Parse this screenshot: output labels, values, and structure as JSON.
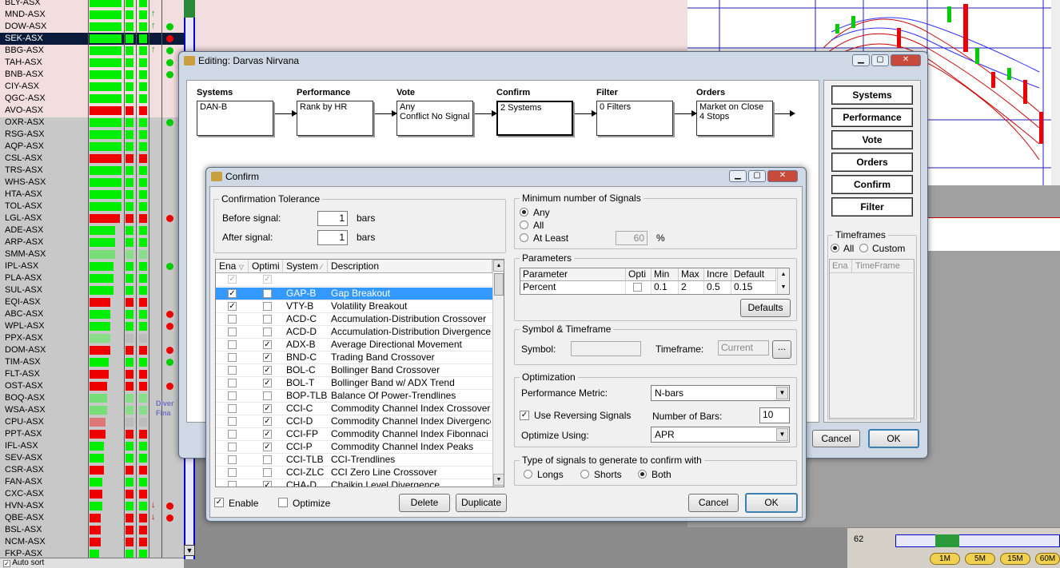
{
  "tickers": [
    {
      "sym": "BLY-ASX",
      "bar": 40,
      "bc": "#00ee00",
      "c1": "#00ee00",
      "c2": "#00ee00",
      "dot": null,
      "arr": ""
    },
    {
      "sym": "MND-ASX",
      "bar": 40,
      "bc": "#00ee00",
      "c1": "#00ee00",
      "c2": "#00ee00",
      "dot": null,
      "arr": "↑"
    },
    {
      "sym": "DOW-ASX",
      "bar": 40,
      "bc": "#00ee00",
      "c1": "#00ee00",
      "c2": "#00ee00",
      "dot": "#00cc00",
      "arr": "↑"
    },
    {
      "sym": "SEK-ASX",
      "bar": 40,
      "bc": "#00ee00",
      "c1": "#00ee00",
      "c2": "#00ee00",
      "dot": "#ee0000",
      "arr": "",
      "sel": true
    },
    {
      "sym": "BBG-ASX",
      "bar": 40,
      "bc": "#00ee00",
      "c1": "#00ee00",
      "c2": "#00ee00",
      "dot": "#00cc00",
      "arr": "↑"
    },
    {
      "sym": "TAH-ASX",
      "bar": 40,
      "bc": "#00ee00",
      "c1": "#00ee00",
      "c2": "#00ee00",
      "dot": "#00cc00",
      "arr": ""
    },
    {
      "sym": "BNB-ASX",
      "bar": 40,
      "bc": "#00ee00",
      "c1": "#00ee00",
      "c2": "#00ee00",
      "dot": "#00cc00",
      "arr": ""
    },
    {
      "sym": "CIY-ASX",
      "bar": 40,
      "bc": "#00ee00",
      "c1": "#00ee00",
      "c2": "#00ee00",
      "dot": null,
      "arr": ""
    },
    {
      "sym": "QGC-ASX",
      "bar": 40,
      "bc": "#00ee00",
      "c1": "#00ee00",
      "c2": "#00ee00",
      "dot": null,
      "arr": ""
    },
    {
      "sym": "AVO-ASX",
      "bar": 40,
      "bc": "#ee0000",
      "c1": "#ee0000",
      "c2": "#ee0000",
      "dot": null,
      "arr": ""
    },
    {
      "sym": "OXR-ASX",
      "bar": 40,
      "bc": "#00ee00",
      "c1": "#00ee00",
      "c2": "#00ee00",
      "dot": "#00cc00",
      "arr": ""
    },
    {
      "sym": "RSG-ASX",
      "bar": 40,
      "bc": "#00ee00",
      "c1": "#00ee00",
      "c2": "#00ee00",
      "dot": null,
      "arr": ""
    },
    {
      "sym": "AQP-ASX",
      "bar": 40,
      "bc": "#00ee00",
      "c1": "#00ee00",
      "c2": "#00ee00",
      "dot": null,
      "arr": ""
    },
    {
      "sym": "CSL-ASX",
      "bar": 40,
      "bc": "#ee0000",
      "c1": "#ee0000",
      "c2": "#ee0000",
      "dot": null,
      "arr": ""
    },
    {
      "sym": "TRS-ASX",
      "bar": 40,
      "bc": "#00ee00",
      "c1": "#00ee00",
      "c2": "#00ee00",
      "dot": null,
      "arr": ""
    },
    {
      "sym": "WHS-ASX",
      "bar": 40,
      "bc": "#00ee00",
      "c1": "#00ee00",
      "c2": "#00ee00",
      "dot": null,
      "arr": ""
    },
    {
      "sym": "HTA-ASX",
      "bar": 40,
      "bc": "#00ee00",
      "c1": "#00ee00",
      "c2": "#00ee00",
      "dot": null,
      "arr": ""
    },
    {
      "sym": "TOL-ASX",
      "bar": 40,
      "bc": "#00ee00",
      "c1": "#00ee00",
      "c2": "#00ee00",
      "dot": null,
      "arr": ""
    },
    {
      "sym": "LGL-ASX",
      "bar": 38,
      "bc": "#ee0000",
      "c1": "#ee0000",
      "c2": "#ee0000",
      "dot": "#ee0000",
      "arr": ""
    },
    {
      "sym": "ADE-ASX",
      "bar": 32,
      "bc": "#00ee00",
      "c1": "#00ee00",
      "c2": "#00ee00",
      "dot": null,
      "arr": ""
    },
    {
      "sym": "ARP-ASX",
      "bar": 32,
      "bc": "#00ee00",
      "c1": "#00ee00",
      "c2": "#00ee00",
      "dot": null,
      "arr": ""
    },
    {
      "sym": "SMM-ASX",
      "bar": 32,
      "bc": "#77dd77",
      "c1": "#88dd88",
      "c2": "#88dd88",
      "dot": null,
      "arr": ""
    },
    {
      "sym": "IPL-ASX",
      "bar": 30,
      "bc": "#00ee00",
      "c1": "#00ee00",
      "c2": "#00ee00",
      "dot": "#00cc00",
      "arr": ""
    },
    {
      "sym": "PLA-ASX",
      "bar": 30,
      "bc": "#00ee00",
      "c1": "#00ee00",
      "c2": "#00ee00",
      "dot": null,
      "arr": ""
    },
    {
      "sym": "SUL-ASX",
      "bar": 30,
      "bc": "#00ee00",
      "c1": "#00ee00",
      "c2": "#00ee00",
      "dot": null,
      "arr": ""
    },
    {
      "sym": "EQI-ASX",
      "bar": 26,
      "bc": "#ee0000",
      "c1": "#ee0000",
      "c2": "#ee0000",
      "dot": null,
      "arr": ""
    },
    {
      "sym": "ABC-ASX",
      "bar": 26,
      "bc": "#00ee00",
      "c1": "#00ee00",
      "c2": "#00ee00",
      "dot": "#ee0000",
      "arr": ""
    },
    {
      "sym": "WPL-ASX",
      "bar": 26,
      "bc": "#00ee00",
      "c1": "#00ee00",
      "c2": "#00ee00",
      "dot": "#ee0000",
      "arr": ""
    },
    {
      "sym": "PPX-ASX",
      "bar": 26,
      "bc": "#88dd88",
      "c1": "#bbbbbb",
      "c2": "#bbbbbb",
      "dot": null,
      "arr": ""
    },
    {
      "sym": "DOM-ASX",
      "bar": 26,
      "bc": "#ee0000",
      "c1": "#ee0000",
      "c2": "#ee0000",
      "dot": "#ee0000",
      "arr": ""
    },
    {
      "sym": "TIM-ASX",
      "bar": 24,
      "bc": "#00ee00",
      "c1": "#00ee00",
      "c2": "#00ee00",
      "dot": "#00cc00",
      "arr": ""
    },
    {
      "sym": "FLT-ASX",
      "bar": 24,
      "bc": "#ee0000",
      "c1": "#ee0000",
      "c2": "#ee0000",
      "dot": null,
      "arr": ""
    },
    {
      "sym": "OST-ASX",
      "bar": 22,
      "bc": "#ee0000",
      "c1": "#ee0000",
      "c2": "#ee0000",
      "dot": "#ee0000",
      "arr": ""
    },
    {
      "sym": "BOQ-ASX",
      "bar": 22,
      "bc": "#77dd77",
      "c1": "#88dd88",
      "c2": "#88dd88",
      "dot": null,
      "arr": ""
    },
    {
      "sym": "WSA-ASX",
      "bar": 22,
      "bc": "#77dd77",
      "c1": "#88dd88",
      "c2": "#88dd88",
      "dot": null,
      "arr": ""
    },
    {
      "sym": "CPU-ASX",
      "bar": 20,
      "bc": "#dd7777",
      "c1": "#bbbbbb",
      "c2": "#bbbbbb",
      "dot": null,
      "arr": ""
    },
    {
      "sym": "PPT-ASX",
      "bar": 20,
      "bc": "#ee0000",
      "c1": "#ee0000",
      "c2": "#ee0000",
      "dot": null,
      "arr": ""
    },
    {
      "sym": "IFL-ASX",
      "bar": 18,
      "bc": "#00ee00",
      "c1": "#00ee00",
      "c2": "#00ee00",
      "dot": null,
      "arr": ""
    },
    {
      "sym": "SEV-ASX",
      "bar": 18,
      "bc": "#00ee00",
      "c1": "#00ee00",
      "c2": "#00ee00",
      "dot": null,
      "arr": ""
    },
    {
      "sym": "CSR-ASX",
      "bar": 18,
      "bc": "#ee0000",
      "c1": "#ee0000",
      "c2": "#ee0000",
      "dot": null,
      "arr": ""
    },
    {
      "sym": "FAN-ASX",
      "bar": 16,
      "bc": "#00ee00",
      "c1": "#00ee00",
      "c2": "#00ee00",
      "dot": null,
      "arr": ""
    },
    {
      "sym": "CXC-ASX",
      "bar": 16,
      "bc": "#ee0000",
      "c1": "#ee0000",
      "c2": "#ee0000",
      "dot": null,
      "arr": ""
    },
    {
      "sym": "HVN-ASX",
      "bar": 16,
      "bc": "#00ee00",
      "c1": "#00ee00",
      "c2": "#00ee00",
      "dot": "#ee0000",
      "arr": "↓"
    },
    {
      "sym": "QBE-ASX",
      "bar": 14,
      "bc": "#ee0000",
      "c1": "#ee0000",
      "c2": "#ee0000",
      "dot": "#ee0000",
      "arr": "↓"
    },
    {
      "sym": "BSL-ASX",
      "bar": 14,
      "bc": "#ee0000",
      "c1": "#ee0000",
      "c2": "#ee0000",
      "dot": null,
      "arr": ""
    },
    {
      "sym": "NCM-ASX",
      "bar": 14,
      "bc": "#ee0000",
      "c1": "#ee0000",
      "c2": "#ee0000",
      "dot": null,
      "arr": ""
    },
    {
      "sym": "FKP-ASX",
      "bar": 12,
      "bc": "#00ee00",
      "c1": "#00ee00",
      "c2": "#00ee00",
      "dot": null,
      "arr": ""
    }
  ],
  "ticker_footer": "Auto sort",
  "bg_text": {
    "diver": "Diver",
    "fina": "Fina"
  },
  "timebar": {
    "value": "62",
    "buttons": [
      "1M",
      "5M",
      "15M",
      "60M"
    ]
  },
  "editor": {
    "title": "Editing: Darvas Nirvana",
    "stages": [
      {
        "title": "Systems",
        "text": "DAN-B"
      },
      {
        "title": "Performance",
        "text": "Rank by HR"
      },
      {
        "title": "Vote",
        "text": "Any\nConflict No Signal"
      },
      {
        "title": "Confirm",
        "text": "2 Systems"
      },
      {
        "title": "Filter",
        "text": "0 Filters"
      },
      {
        "title": "Orders",
        "text": "Market on Close\n4 Stops"
      }
    ],
    "side_buttons": [
      "Systems",
      "Performance",
      "Vote",
      "Orders",
      "Confirm",
      "Filter"
    ],
    "timeframes": {
      "label": "Timeframes",
      "all": "All",
      "custom": "Custom",
      "col1": "Ena",
      "col2": "TimeFrame"
    },
    "cancel": "Cancel",
    "ok": "OK"
  },
  "confirm": {
    "title": "Confirm",
    "tolerance": {
      "label": "Confirmation Tolerance",
      "before_label": "Before signal:",
      "before_value": "1",
      "after_label": "After signal:",
      "after_value": "1",
      "unit": "bars"
    },
    "grid_headers": [
      "Ena",
      "Optimi",
      "System",
      "Description"
    ],
    "systems": [
      {
        "ena": true,
        "opt": false,
        "sys": "GAP-B",
        "desc": "Gap Breakout",
        "sel": true
      },
      {
        "ena": true,
        "opt": false,
        "sys": "VTY-B",
        "desc": "Volatility Breakout"
      },
      {
        "ena": false,
        "opt": false,
        "sys": "ACD-C",
        "desc": "Accumulation-Distribution Crossover"
      },
      {
        "ena": false,
        "opt": false,
        "sys": "ACD-D",
        "desc": "Accumulation-Distribution Divergence"
      },
      {
        "ena": false,
        "opt": true,
        "sys": "ADX-B",
        "desc": "Average Directional Movement"
      },
      {
        "ena": false,
        "opt": true,
        "sys": "BND-C",
        "desc": "Trading Band Crossover"
      },
      {
        "ena": false,
        "opt": true,
        "sys": "BOL-C",
        "desc": "Bollinger Band Crossover"
      },
      {
        "ena": false,
        "opt": true,
        "sys": "BOL-T",
        "desc": "Bollinger Band w/ ADX Trend"
      },
      {
        "ena": false,
        "opt": false,
        "sys": "BOP-TLB",
        "desc": "Balance Of Power-Trendlines"
      },
      {
        "ena": false,
        "opt": true,
        "sys": "CCI-C",
        "desc": "Commodity Channel Index Crossover"
      },
      {
        "ena": false,
        "opt": true,
        "sys": "CCI-D",
        "desc": "Commodity Channel Index Divergence"
      },
      {
        "ena": false,
        "opt": true,
        "sys": "CCI-FP",
        "desc": "Commodity Channel Index Fibonnaci P"
      },
      {
        "ena": false,
        "opt": true,
        "sys": "CCI-P",
        "desc": "Commodity Channel Index Peaks"
      },
      {
        "ena": false,
        "opt": false,
        "sys": "CCI-TLB",
        "desc": "CCI-Trendlines"
      },
      {
        "ena": false,
        "opt": false,
        "sys": "CCI-ZLC",
        "desc": "CCI Zero Line Crossover"
      },
      {
        "ena": false,
        "opt": true,
        "sys": "CHA-D",
        "desc": "Chaikin Level Divergence"
      }
    ],
    "enable_label": "Enable",
    "optimize_label": "Optimize",
    "delete": "Delete",
    "duplicate": "Duplicate",
    "min_signals": {
      "label": "Minimum number of Signals",
      "any": "Any",
      "all": "All",
      "at_least": "At Least",
      "value": "60",
      "unit": "%"
    },
    "parameters": {
      "label": "Parameters",
      "headers": [
        "Parameter",
        "Opti",
        "Min",
        "Max",
        "Incre",
        "Default"
      ],
      "row": [
        "Percent",
        "",
        "0.1",
        "2",
        "0.5",
        "0.15"
      ],
      "defaults": "Defaults"
    },
    "symbol_tf": {
      "label": "Symbol & Timeframe",
      "symbol_label": "Symbol:",
      "timeframe_label": "Timeframe:",
      "timeframe_value": "Current",
      "browse": "..."
    },
    "optimization": {
      "label": "Optimization",
      "metric_label": "Performance Metric:",
      "metric_value": "N-bars",
      "reversing_label": "Use Reversing Signals",
      "bars_label": "Number of Bars:",
      "bars_value": "10",
      "using_label": "Optimize Using:",
      "using_value": "APR"
    },
    "signal_type": {
      "label": "Type of signals to generate to confirm with",
      "longs": "Longs",
      "shorts": "Shorts",
      "both": "Both"
    },
    "cancel": "Cancel",
    "ok": "OK"
  },
  "colors": {
    "selection": "#3399ff",
    "title_bar": "#cfd9e6",
    "close": "#c84a3a"
  }
}
